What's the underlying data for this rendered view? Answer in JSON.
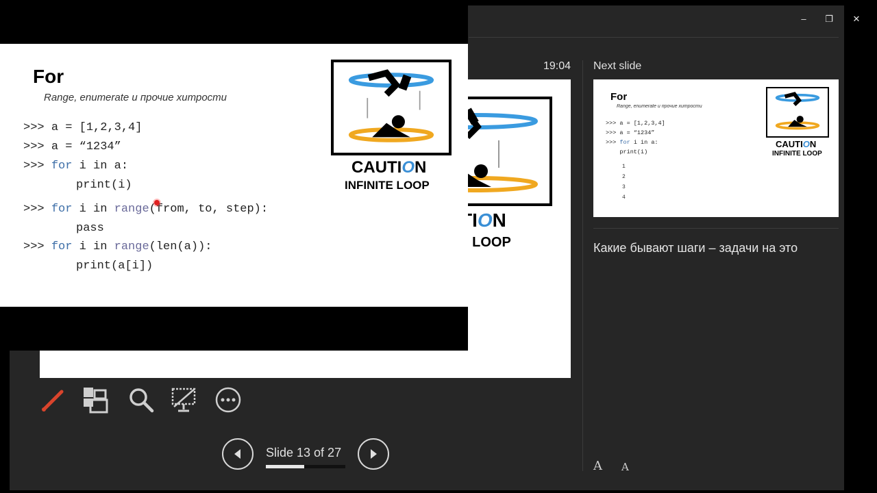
{
  "window": {
    "minimize_label": "–",
    "restore_label": "❐",
    "close_label": "✕"
  },
  "presenter": {
    "timer": "19:04",
    "next_slide_label": "Next slide",
    "notes": "Какие бывают шаги – задачи на это",
    "slide_counter": "Slide 13 of 27",
    "progress_fraction": 0.48,
    "font_increase_label": "A",
    "font_decrease_label": "A",
    "tools": [
      "pen-icon",
      "slides-grid-icon",
      "zoom-icon",
      "screen-off-icon",
      "more-options-icon"
    ]
  },
  "slide": {
    "title": "For",
    "subtitle": "Range, enumerate и прочие хитрости",
    "caution_word_start": "CAUTI",
    "caution_word_o": "O",
    "caution_word_end": "N",
    "caution_line2": "INFINITE LOOP",
    "code": {
      "l1_prompt": ">>> ",
      "l1_text": "a = [1,2,3,4]",
      "l2_prompt": ">>> ",
      "l2_text": "a = “1234”",
      "l3_prompt": ">>> ",
      "l3_kw": "for",
      "l3_text": " i in a:",
      "l4_text": "print(i)",
      "l5_prompt": ">>> ",
      "l5_kw": "for",
      "l5_mid": " i in ",
      "l5_fn": "range",
      "l5_text": "(from, to, step):",
      "l6_text": "pass",
      "l7_prompt": ">>> ",
      "l7_kw": "for",
      "l7_mid": " i in ",
      "l7_fn": "range",
      "l7_text": "(len(a)):",
      "l8_text": "print(a[i])"
    }
  },
  "background_slide": {
    "caution_word_o": "O",
    "caution_word_end": "UTI",
    "caution_word_n": "N",
    "caution_line2": "NITE LOOP"
  },
  "next_slide": {
    "title": "For",
    "subtitle": "Range, enumerate и прочие хитрости",
    "code_l1": ">>> a = [1,2,3,4]",
    "code_l2": ">>> a = “1234”",
    "code_l3_prompt": ">>> ",
    "code_l3_kw": "for",
    "code_l3_text": " i in a:",
    "code_l4": "    print(i)",
    "outputs": [
      "1",
      "2",
      "3",
      "4"
    ],
    "caution_word_start": "CAUTI",
    "caution_word_o": "O",
    "caution_word_end": "N",
    "caution_line2": "INFINITE LOOP"
  },
  "colors": {
    "presenter_bg": "#262626",
    "keyword": "#3e6fa8",
    "pen": "#d9442c",
    "portal_blue": "#3a9be0",
    "portal_orange": "#f0a820"
  }
}
